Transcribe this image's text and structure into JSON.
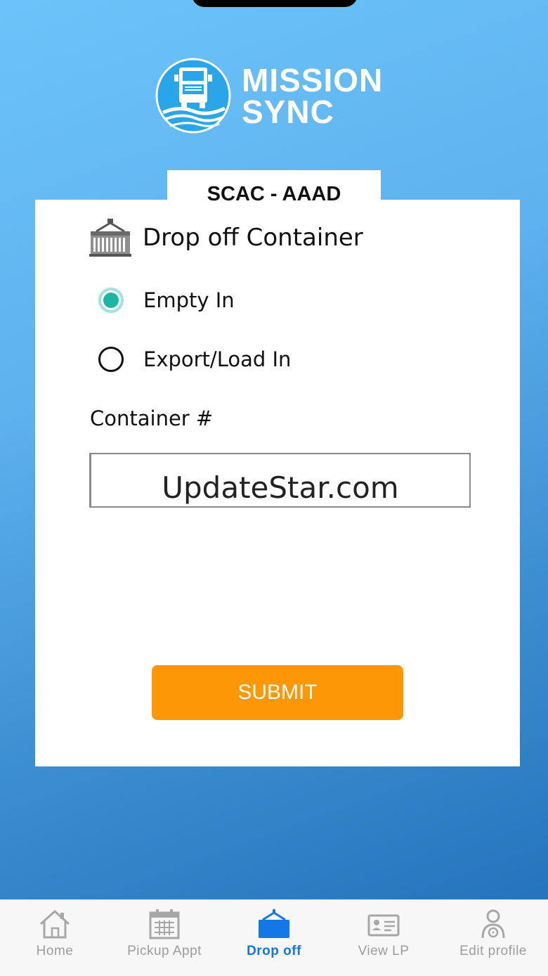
{
  "brand": {
    "line1": "MISSION",
    "line2": "SYNC"
  },
  "header": {
    "title": "SCAC - AAAD"
  },
  "form": {
    "section_title": "Drop off Container",
    "options": [
      {
        "label": "Empty In",
        "selected": true
      },
      {
        "label": "Export/Load In",
        "selected": false
      }
    ],
    "container_label": "Container #",
    "container_value": "UpdateStar.com",
    "submit_label": "SUBMIT"
  },
  "tabs": [
    {
      "label": "Home",
      "icon": "home-icon",
      "active": false
    },
    {
      "label": "Pickup Appt",
      "icon": "calendar-icon",
      "active": false
    },
    {
      "label": "Drop off",
      "icon": "container-crane-icon",
      "active": true
    },
    {
      "label": "View LP",
      "icon": "id-card-icon",
      "active": false
    },
    {
      "label": "Edit profile",
      "icon": "driver-icon",
      "active": false
    }
  ],
  "colors": {
    "accent": "#1cb7a3",
    "submit": "#fe9705",
    "active_tab": "#1477e6"
  }
}
